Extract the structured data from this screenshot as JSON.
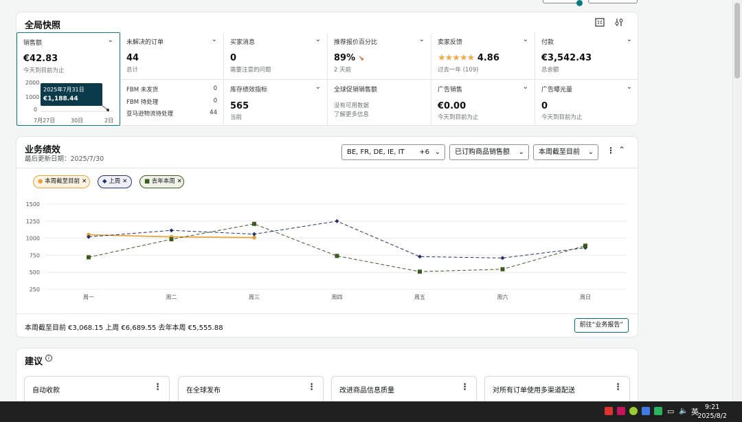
{
  "snapshot": {
    "title": "全局快照",
    "tiles": [
      {
        "label": "销售额",
        "value": "€42.83",
        "sub": "今天到目前为止"
      },
      {
        "label": "未解决的订单",
        "value": "44",
        "sub": "总计"
      },
      {
        "label": "买家消息",
        "value": "0",
        "sub": "需要注意的问题"
      },
      {
        "label": "推荐报价百分比",
        "value": "89%",
        "sub": "2 天前"
      },
      {
        "label": "卖家反馈",
        "value": "4.86",
        "sub": "过去一年 (109)"
      },
      {
        "label": "付款",
        "value": "€3,542.43",
        "sub": "总余额"
      },
      {
        "label": "库存绩效指标",
        "value": "565",
        "sub": "当前"
      },
      {
        "label": "全球促销销售额",
        "value": "",
        "sub": "没有可用数据"
      },
      {
        "label": "广告销售",
        "value": "€0.00",
        "sub": "今天到目前为止"
      },
      {
        "label": "广告曝光量",
        "value": "0",
        "sub": "今天到目前为止"
      }
    ],
    "more_info_link": "了解更多信息",
    "fbm": [
      {
        "label": "FBM 未发货",
        "value": "0"
      },
      {
        "label": "FBM 待处理",
        "value": "0"
      },
      {
        "label": "亚马逊物流待处理",
        "value": "44"
      }
    ],
    "mini_chart": {
      "y_ticks": [
        "2000",
        "1000",
        "0"
      ],
      "x_ticks": [
        "7月27日",
        "30日",
        "2日"
      ],
      "tooltip_date": "2025年7月31日",
      "tooltip_amount": "€1,188.44"
    }
  },
  "performance": {
    "title": "业务绩效",
    "updated": "最后更新日期：2025/7/30",
    "marketplace": "BE, FR, DE, IE, IT",
    "marketplace_more": "+6",
    "metric": "已订购商品销售额",
    "period": "本周截至目前",
    "totals_text": "本周截至目前 €3,068.15   上周 €6,689.55   去年本周 €5,555.88",
    "report_button": "前往“业务报告”"
  },
  "chart_data": {
    "type": "line",
    "categories": [
      "周一",
      "周二",
      "周三",
      "周四",
      "周五",
      "周六",
      "周日"
    ],
    "y_ticks": [
      1500,
      1250,
      1000,
      750,
      500,
      250
    ],
    "ylim": [
      250,
      1500
    ],
    "legend_position": "top-left",
    "series": [
      {
        "name": "本周截至目前",
        "color": "#e8a33d",
        "dash": false,
        "marker": "circle",
        "values": [
          1050,
          1020,
          1010,
          null,
          null,
          null,
          null
        ]
      },
      {
        "name": "上周",
        "color": "#232f6e",
        "dash": true,
        "marker": "diamond",
        "values": [
          1020,
          1115,
          1060,
          1250,
          730,
          710,
          860
        ]
      },
      {
        "name": "去年本周",
        "color": "#3d5a1f",
        "dash": true,
        "marker": "square",
        "values": [
          720,
          985,
          1210,
          740,
          510,
          545,
          890
        ]
      }
    ]
  },
  "recommendations": {
    "title": "建议",
    "cards": [
      "自动收款",
      "在全球发布",
      "改进商品信息质量",
      "对所有订单使用多渠道配送"
    ]
  },
  "taskbar": {
    "ime": "英",
    "time": "9:21",
    "date": "2025/8/2"
  }
}
